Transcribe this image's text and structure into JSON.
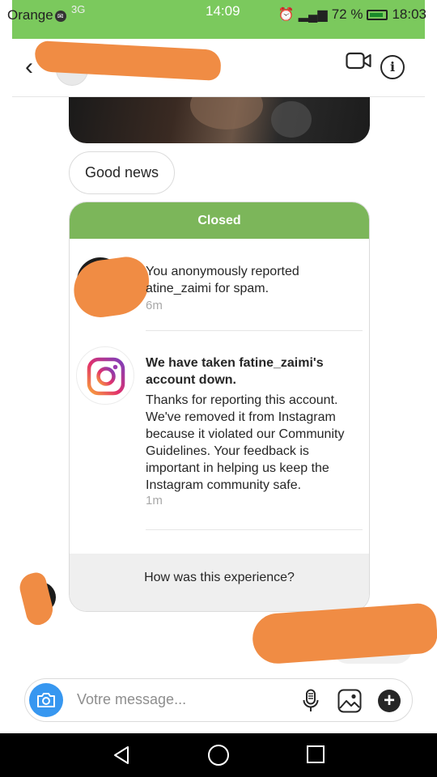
{
  "status_bar": {
    "carrier": "Orange",
    "network_type": "3G",
    "time_center": "14:09",
    "battery_percent": "72 %",
    "time_right": "18:03"
  },
  "header": {
    "icons": [
      "back-chevron-icon",
      "video-call-icon",
      "info-icon"
    ]
  },
  "messages": {
    "bubble_text": "Good news"
  },
  "report_card": {
    "status": "Closed",
    "report_line": "You anonymously reported atine_zaimi for spam.",
    "report_time": "6m",
    "result_title": "We have taken fatine_zaimi's account down.",
    "result_body": "Thanks for reporting this account. We've removed it from Instagram because it violated our Community Guidelines. Your feedback is important in helping us keep the Instagram community safe.",
    "result_time": "1m",
    "feedback_prompt": "How was this experience?"
  },
  "composer": {
    "placeholder": "Votre message..."
  },
  "colors": {
    "status_green": "#7bc95d",
    "card_header_green": "#7cb65a",
    "camera_blue": "#3797f0",
    "redaction_orange": "#f08c44"
  }
}
